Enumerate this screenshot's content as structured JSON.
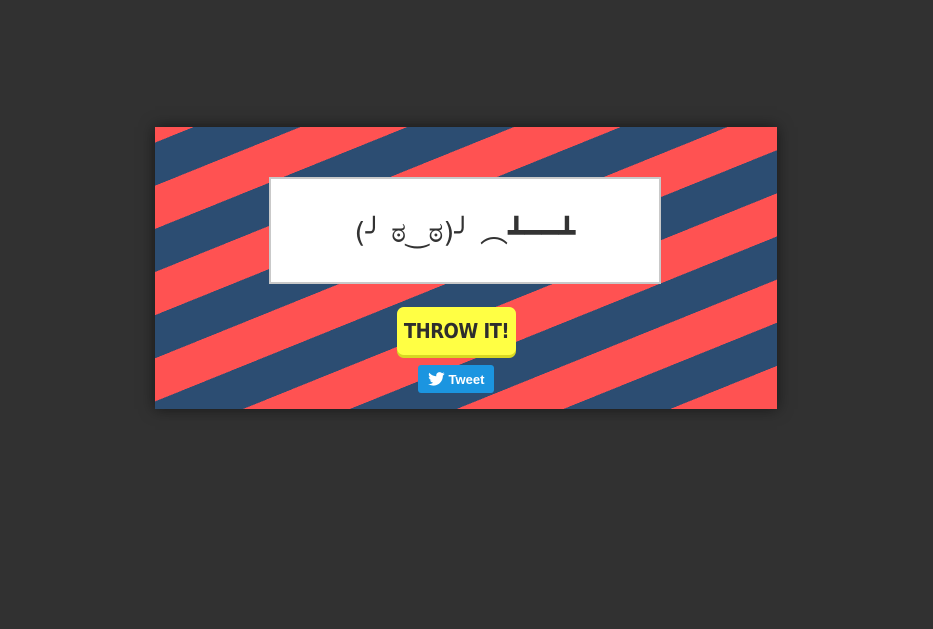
{
  "flip": {
    "emoticon": "(╯ ಠ‿ಠ)╯ ︵┻━━┻"
  },
  "actions": {
    "throw_label": "THROW IT!",
    "tweet_label": "Tweet",
    "tweet_icon": "twitter-bird-icon"
  },
  "colors": {
    "background": "#313131",
    "stripe_red": "#ff5252",
    "stripe_blue": "#2c4d72",
    "throw_button": "#ffff44",
    "tweet_button": "#1b95e0"
  }
}
